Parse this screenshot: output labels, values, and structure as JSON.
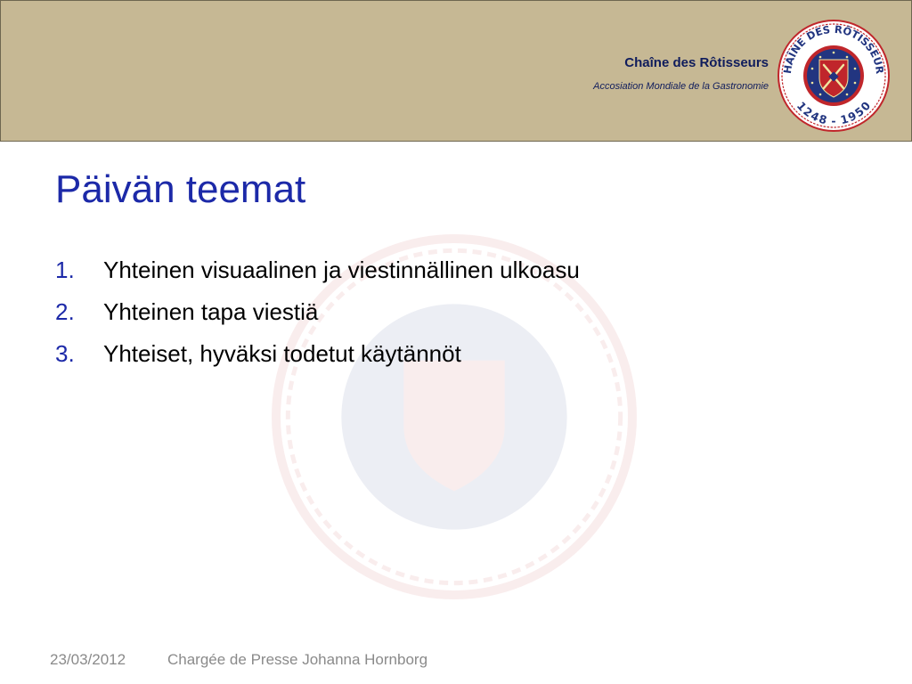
{
  "header": {
    "org_name": "Chaîne des Rôtisseurs",
    "org_subtitle": "Accosiation Mondiale de la Gastronomie",
    "logo": {
      "icon": "rotisseurs-emblem-icon",
      "ring_top_text": "CHAÎNE DES RÔTISSEURS",
      "ring_bottom_text": "1248 - 1950",
      "colors": {
        "ring": "#ffffff",
        "outer_red": "#c0262b",
        "blue": "#223580",
        "shield": "#c0262b"
      }
    }
  },
  "slide": {
    "title": "Päivän teemat",
    "items": [
      {
        "number": "1.",
        "text": "Yhteinen visuaalinen ja viestinnällinen ulkoasu"
      },
      {
        "number": "2.",
        "text": "Yhteinen tapa viestiä"
      },
      {
        "number": "3.",
        "text": "Yhteiset, hyväksi todetut käytännöt"
      }
    ]
  },
  "footer": {
    "date": "23/03/2012",
    "author": "Chargée de Presse Johanna Hornborg"
  },
  "colors": {
    "header_bg": "#c6b894",
    "title": "#1c29a8",
    "org_text": "#0f1c5c",
    "footer_text": "#8a8a8a"
  }
}
